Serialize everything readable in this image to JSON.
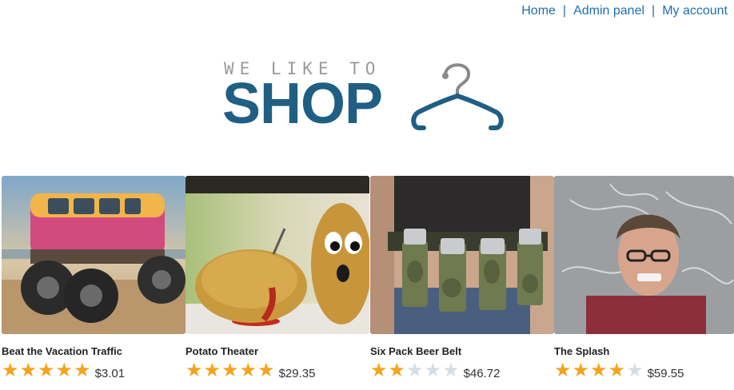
{
  "nav": {
    "home": "Home",
    "separator": "|",
    "admin": "Admin panel",
    "account": "My account"
  },
  "logo": {
    "tagline": "WE LIKE TO",
    "word": "SHOP",
    "icon": "hanger-icon",
    "word_color": "#1f5f83",
    "tagline_color": "#9a9a9a"
  },
  "products": [
    {
      "name": "Beat the Vacation Traffic",
      "price": "$3.01",
      "rating": 5,
      "max_rating": 5,
      "image": "monster-van-photo"
    },
    {
      "name": "Potato Theater",
      "price": "$29.35",
      "rating": 5,
      "max_rating": 5,
      "image": "potato-photo"
    },
    {
      "name": "Six Pack Beer Belt",
      "price": "$46.72",
      "rating": 2,
      "max_rating": 5,
      "image": "beer-belt-photo"
    },
    {
      "name": "The Splash",
      "price": "$59.55",
      "rating": 4,
      "max_rating": 5,
      "image": "splash-photo"
    }
  ],
  "colors": {
    "link": "#1f6fae",
    "star_on": "#f2a41c",
    "star_off": "#d5dde2"
  }
}
